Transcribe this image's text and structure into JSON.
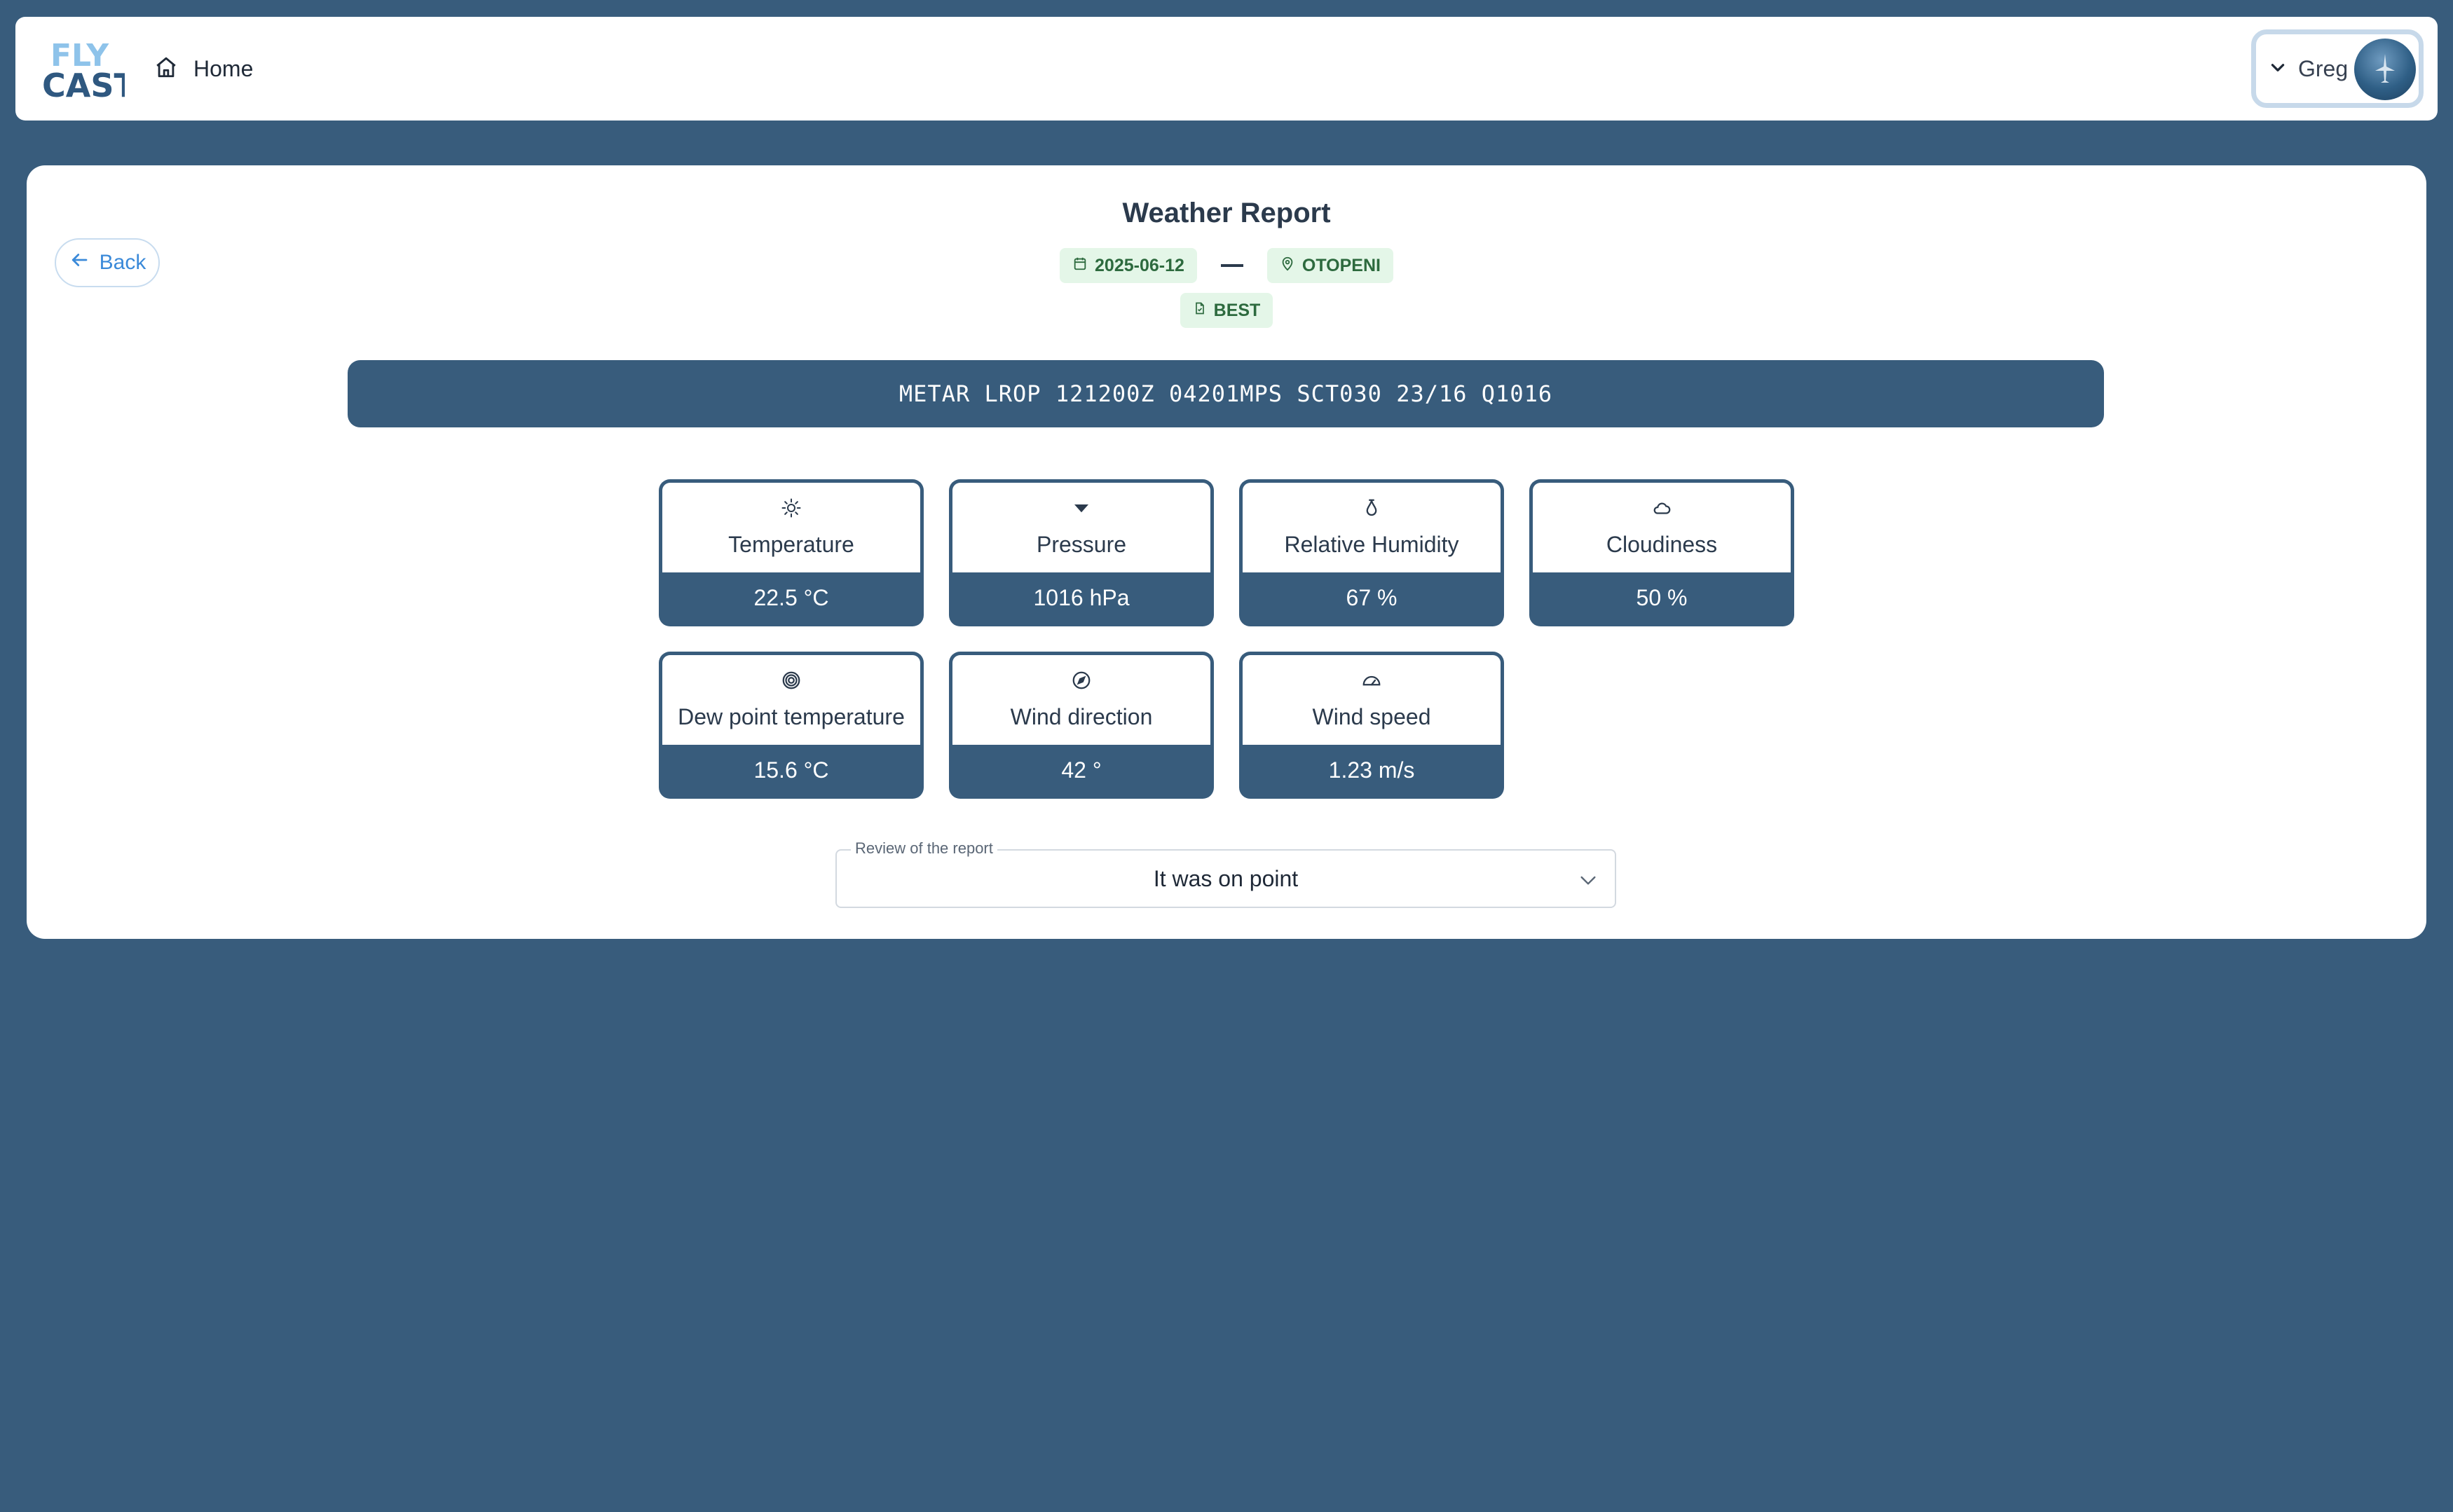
{
  "navbar": {
    "logo_text_top": "FLY",
    "logo_text_bottom": "CAST",
    "home_label": "Home",
    "user_name": "Greg"
  },
  "report": {
    "back_label": "Back",
    "title": "Weather Report",
    "date": "2025-06-12",
    "location": "OTOPENI",
    "source": "BEST",
    "metar": "METAR LROP 121200Z 04201MPS SCT030 23/16 Q1016"
  },
  "metrics": [
    {
      "label": "Temperature",
      "value": "22.5 °C",
      "icon": "sun-icon"
    },
    {
      "label": "Pressure",
      "value": "1016 hPa",
      "icon": "caret-down-icon"
    },
    {
      "label": "Relative Humidity",
      "value": "67 %",
      "icon": "droplet-icon"
    },
    {
      "label": "Cloudiness",
      "value": "50 %",
      "icon": "cloud-icon"
    },
    {
      "label": "Dew point temperature",
      "value": "15.6 °C",
      "icon": "target-icon"
    },
    {
      "label": "Wind direction",
      "value": "42 °",
      "icon": "compass-icon"
    },
    {
      "label": "Wind speed",
      "value": "1.23 m/s",
      "icon": "gauge-icon"
    }
  ],
  "review": {
    "legend": "Review of the report",
    "selected": "It was on point"
  },
  "colors": {
    "background": "#385c7c",
    "accent": "#3b8ad9",
    "tag_bg": "#e4f6e8",
    "tag_text": "#2d6a3e"
  }
}
